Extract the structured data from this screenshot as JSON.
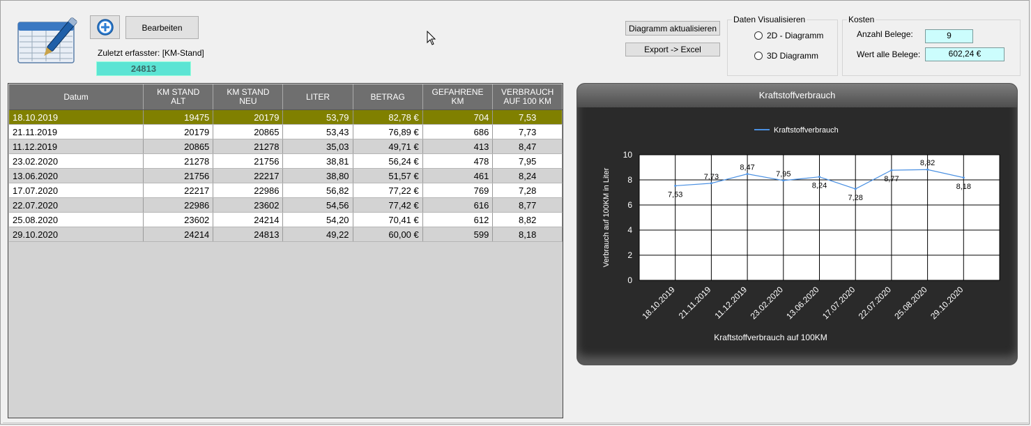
{
  "toolbar": {
    "add_icon": "plus-circle-icon",
    "edit_label": "Bearbeiten",
    "last_label": "Zuletzt erfasster: [KM-Stand]",
    "last_km": "24813",
    "update_chart_label": "Diagramm aktualisieren",
    "export_label": "Export -> Excel"
  },
  "visualize": {
    "title": "Daten Visualisieren",
    "opt_2d": "2D - Diagramm",
    "opt_3d": "3D Diagramm"
  },
  "costs": {
    "title": "Kosten",
    "count_label": "Anzahl Belege:",
    "count_value": "9",
    "sum_label": "Wert alle Belege:",
    "sum_value": "602,24 €"
  },
  "table": {
    "headers": [
      "Datum",
      "KM STAND\nALT",
      "KM STAND\nNEU",
      "LITER",
      "BETRAG",
      "GEFAHRENE\nKM",
      "VERBRAUCH\nAUF 100 KM"
    ],
    "rows": [
      [
        "18.10.2019",
        "19475",
        "20179",
        "53,79",
        "82,78 €",
        "704",
        "7,53"
      ],
      [
        "21.11.2019",
        "20179",
        "20865",
        "53,43",
        "76,89 €",
        "686",
        "7,73"
      ],
      [
        "11.12.2019",
        "20865",
        "21278",
        "35,03",
        "49,71 €",
        "413",
        "8,47"
      ],
      [
        "23.02.2020",
        "21278",
        "21756",
        "38,81",
        "56,24 €",
        "478",
        "7,95"
      ],
      [
        "13.06.2020",
        "21756",
        "22217",
        "38,80",
        "51,57 €",
        "461",
        "8,24"
      ],
      [
        "17.07.2020",
        "22217",
        "22986",
        "56,82",
        "77,22 €",
        "769",
        "7,28"
      ],
      [
        "22.07.2020",
        "22986",
        "23602",
        "54,56",
        "77,42 €",
        "616",
        "8,77"
      ],
      [
        "25.08.2020",
        "23602",
        "24214",
        "54,20",
        "70,41 €",
        "612",
        "8,82"
      ],
      [
        "29.10.2020",
        "24214",
        "24813",
        "49,22",
        "60,00 €",
        "599",
        "8,18"
      ]
    ],
    "selected_row": 0
  },
  "chart_data": {
    "type": "line",
    "title": "Kraftstoffverbrauch",
    "xlabel": "Kraftstoffverbrauch auf 100KM",
    "ylabel": "Verbrauch auf 100KM in Liter",
    "ylim": [
      0,
      10
    ],
    "yticks": [
      0,
      2,
      4,
      6,
      8,
      10
    ],
    "grid": true,
    "legend_position": "top",
    "categories": [
      "18.10.2019",
      "21.11.2019",
      "11.12.2019",
      "23.02.2020",
      "13.06.2020",
      "17.07.2020",
      "22.07.2020",
      "25.08.2020",
      "29.10.2020"
    ],
    "series": [
      {
        "name": "Kraftstoffverbrauch",
        "values": [
          7.53,
          7.73,
          8.47,
          7.95,
          8.24,
          7.28,
          8.77,
          8.82,
          8.18
        ],
        "labels": [
          "7,53",
          "7,73",
          "8,47",
          "7,95",
          "8,24",
          "7,28",
          "8,77",
          "8,82",
          "8,18"
        ],
        "color": "#4a90e2"
      }
    ]
  }
}
